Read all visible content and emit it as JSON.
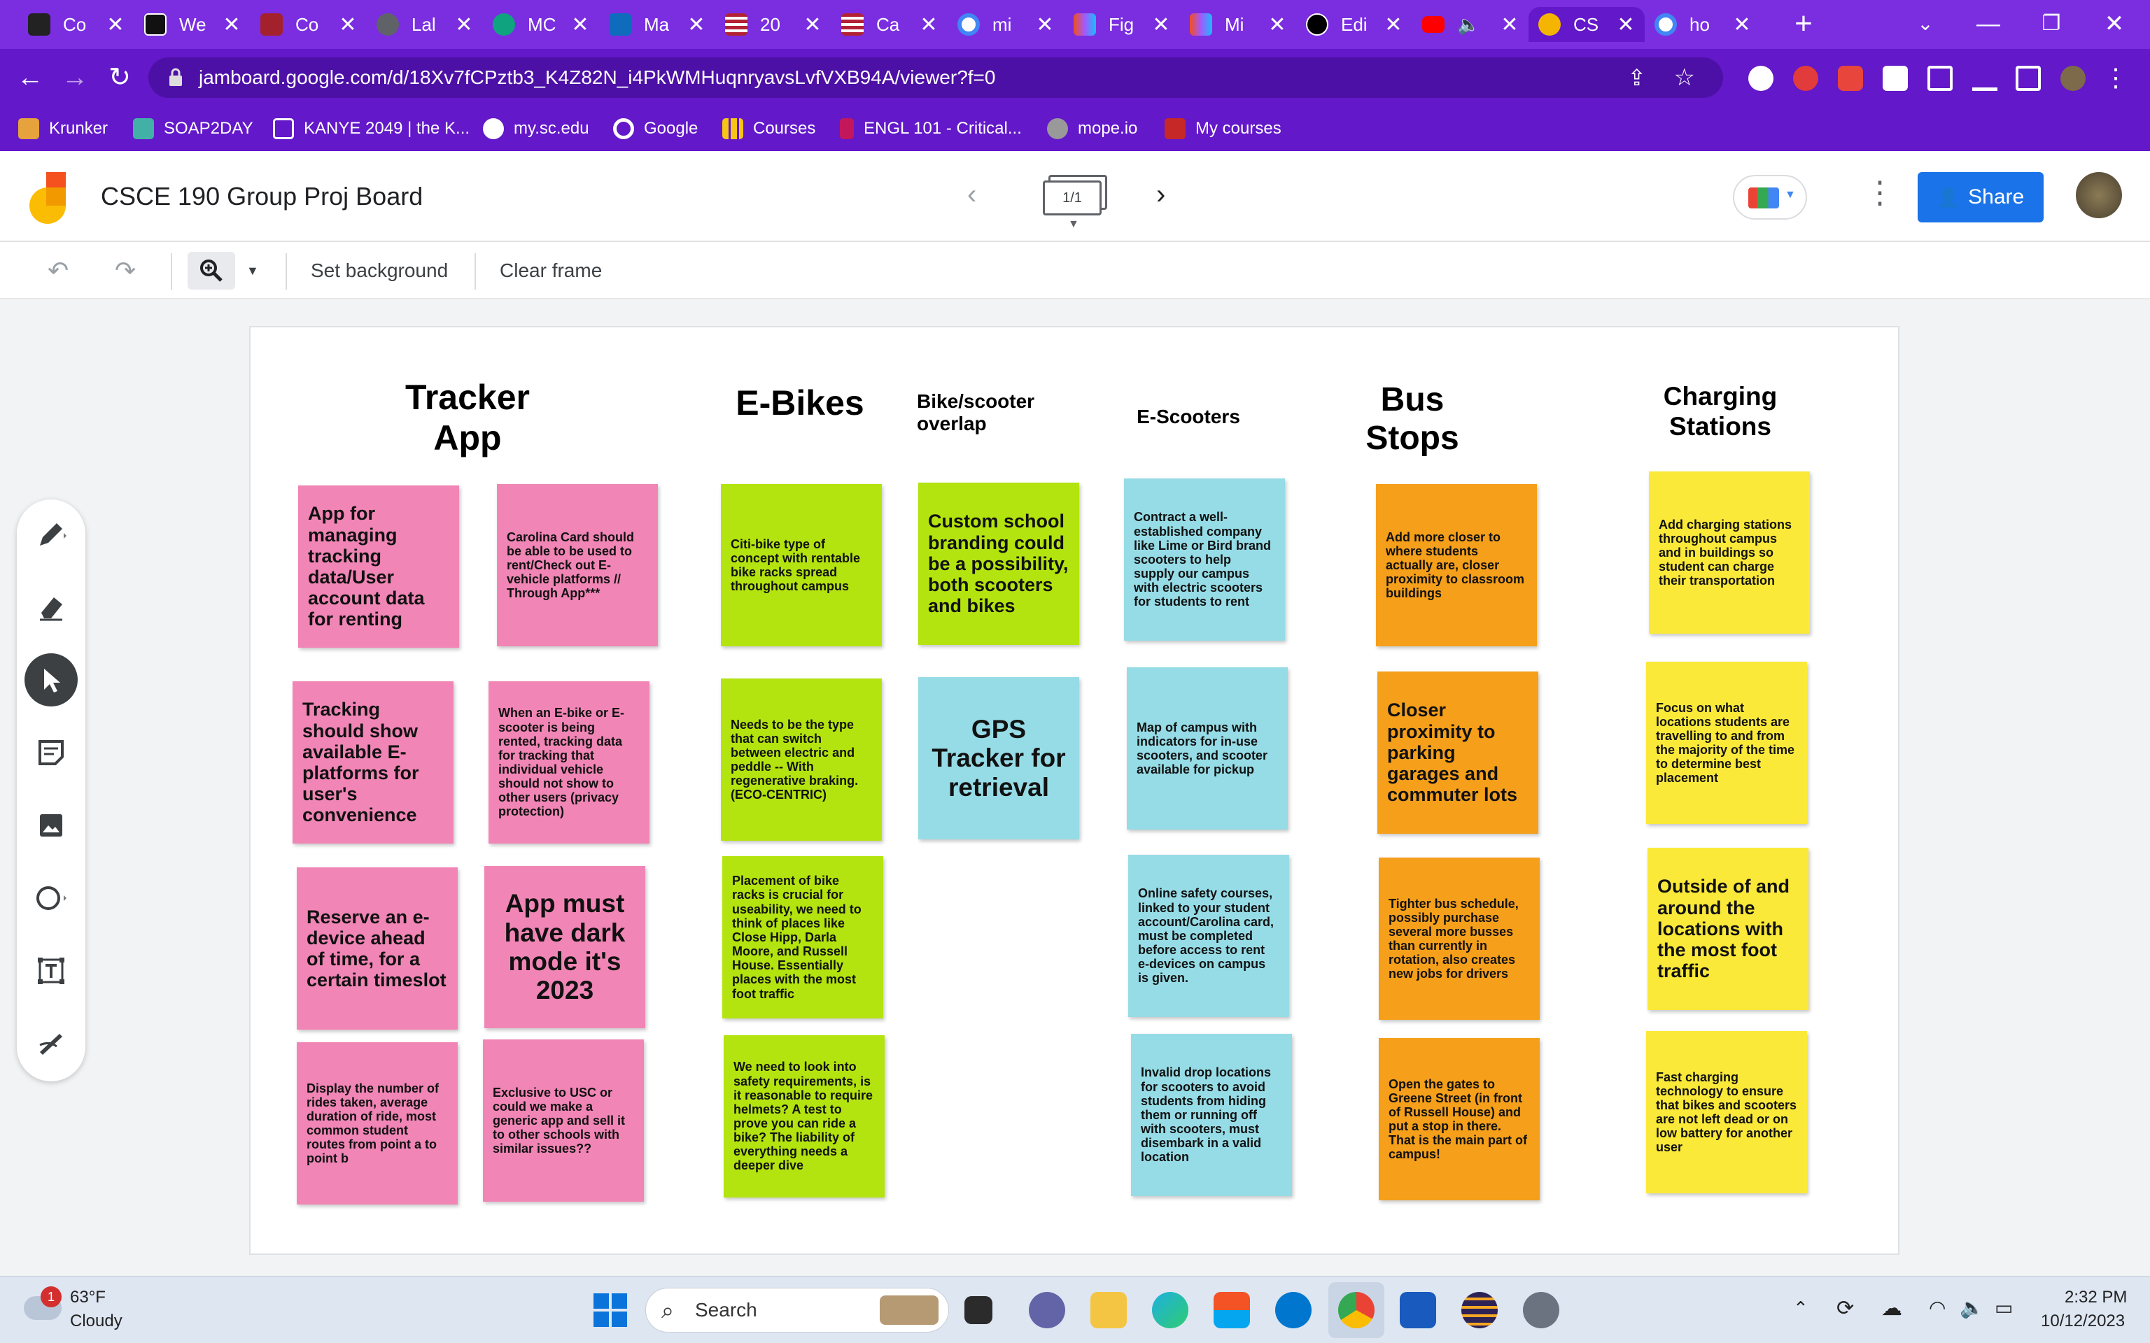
{
  "browser": {
    "tabs": [
      {
        "title": "Co",
        "icon": "chart-icon",
        "color": "#222222"
      },
      {
        "title": "We",
        "icon": "blackboard-icon",
        "color": "#111111"
      },
      {
        "title": "Co",
        "icon": "figure-icon",
        "color": "#a3212d"
      },
      {
        "title": "Lal",
        "icon": "globe-icon",
        "color": "#5f6368"
      },
      {
        "title": "MC",
        "icon": "openai-icon",
        "color": "#10a37f"
      },
      {
        "title": "Ma",
        "icon": "outlook-icon",
        "color": "#0f6cbd"
      },
      {
        "title": "20",
        "icon": "flag-icon",
        "color": "#b22234"
      },
      {
        "title": "Ca",
        "icon": "flag-icon",
        "color": "#b22234"
      },
      {
        "title": "mi",
        "icon": "google-icon",
        "color": "#ffffff"
      },
      {
        "title": "Fig",
        "icon": "figma-icon",
        "color": "#1e1e1e"
      },
      {
        "title": "Mi",
        "icon": "figma-icon",
        "color": "#1e1e1e"
      },
      {
        "title": "Edi",
        "icon": "github-icon",
        "color": "#000000"
      },
      {
        "title": "",
        "icon": "youtube-icon",
        "color": "#ff0000"
      },
      {
        "title": "CS",
        "icon": "jamboard-icon",
        "color": "#f4b400"
      },
      {
        "title": "ho",
        "icon": "google-icon",
        "color": "#ffffff"
      }
    ],
    "url": "jamboard.google.com/d/18Xv7fCPztb3_K4Z82N_i4PkWMHuqnryavsLvfVXB94A/viewer?f=0",
    "bookmarks": [
      {
        "label": "Krunker",
        "color": "#e6a23c"
      },
      {
        "label": "SOAP2DAY",
        "color": "#43b0a8"
      },
      {
        "label": "KANYE 2049 | the K...",
        "color": "#ffffff"
      },
      {
        "label": "my.sc.edu",
        "color": "#ffffff"
      },
      {
        "label": "Google",
        "color": "#ffffff"
      },
      {
        "label": "Courses",
        "color": "#f5c518"
      },
      {
        "label": "ENGL 101 - Critical...",
        "color": "#c2185b"
      },
      {
        "label": "mope.io",
        "color": "#999999"
      },
      {
        "label": "My courses",
        "color": "#c62828"
      }
    ]
  },
  "jamboard": {
    "title": "CSCE 190 Group Proj Board",
    "frame_indicator": "1/1",
    "share_label": "Share",
    "toolbar": {
      "set_background": "Set background",
      "clear_frame": "Clear frame"
    }
  },
  "board": {
    "columns": [
      {
        "heading": "Tracker App"
      },
      {
        "heading": "E-Bikes"
      },
      {
        "heading": "Bike/scooter overlap"
      },
      {
        "heading": "E-Scooters"
      },
      {
        "heading": "Bus Stops"
      },
      {
        "heading": "Charging Stations"
      }
    ],
    "notes": [
      "App for managing tracking data/User account data for renting",
      "Carolina Card should be able to be used to rent/Check out E-vehicle platforms // Through App***",
      "Tracking should show available E-platforms for user's convenience",
      "When an E-bike or E-scooter is being rented, tracking data for tracking that individual vehicle should not show to other users (privacy protection)",
      "Reserve an e-device ahead of time, for a certain timeslot",
      "App must have dark mode it's 2023",
      "Display the number of rides taken, average duration of ride, most common student routes from point a to point b",
      "Exclusive to USC or could we make a generic app and sell it to other schools with similar issues??",
      "Citi-bike type of concept with rentable bike racks spread throughout campus",
      "Needs to be the type that can switch between electric and peddle -- With regenerative braking. (ECO-CENTRIC)",
      "Placement of bike racks is crucial for useability, we need to think of places like Close Hipp, Darla Moore, and Russell House. Essentially places with the most foot traffic",
      "We need to look into safety requirements, is it reasonable to require helmets? A test to prove you can ride a bike? The liability of everything needs a deeper dive",
      "Custom school branding could be a possibility, both scooters and bikes",
      "GPS Tracker for retrieval",
      "Contract a well-established company like Lime or Bird brand scooters to help supply our campus with electric scooters for students to rent",
      "Map of campus with indicators for in-use scooters, and scooter available for pickup",
      "Online safety courses, linked to your student account/Carolina card, must be completed before access to rent e-devices on campus is given.",
      "Invalid drop locations for scooters to avoid students from hiding them or running off with scooters, must disembark in a valid location",
      "Add more closer to where students actually are, closer proximity to classroom buildings",
      "Closer proximity to parking garages and commuter lots",
      "Tighter bus schedule, possibly purchase several more busses than currently in rotation, also creates new jobs for drivers",
      "Open the gates to Greene Street (in front of Russell House) and put a stop in there. That is the main part of campus!",
      "Add charging stations throughout campus and in buildings so student can charge their transportation",
      "Focus on what locations students are travelling to and from the majority of the time to determine best placement",
      "Outside of and around the locations with the most foot traffic",
      "Fast charging technology to ensure that bikes and scooters are not left dead or on low battery for another user"
    ]
  },
  "taskbar": {
    "weather_temp": "63°F",
    "weather_desc": "Cloudy",
    "weather_badge": "1",
    "search_label": "Search",
    "time": "2:32 PM",
    "date": "10/12/2023"
  },
  "colors": {
    "chrome_purple": "#6318c9",
    "note_pink": "#f186b6",
    "note_green": "#b4e40f",
    "note_blue": "#96dce6",
    "note_orange": "#f59f1b",
    "note_yellow": "#fbe93a",
    "share_blue": "#1a73e8"
  }
}
